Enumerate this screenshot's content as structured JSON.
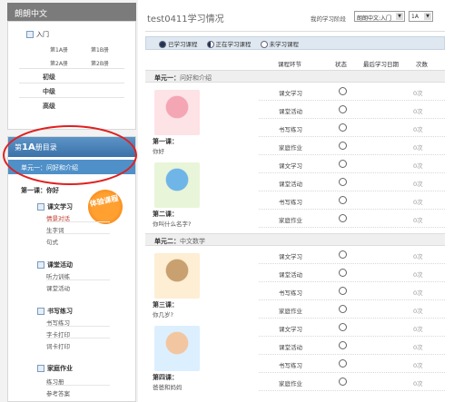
{
  "brand": "朗朗中文",
  "nav": {
    "rumen": "入门",
    "books": [
      "第1A册",
      "第1B册",
      "第2A册",
      "第2B册"
    ],
    "levels": [
      "初级",
      "中级",
      "高级"
    ]
  },
  "directory": {
    "prefix": "第",
    "book": "1A",
    "suffix": "册目录",
    "unit": "单元一：问好和介绍",
    "lesson": "第一课：你好",
    "badge": "体验课程",
    "sections": [
      {
        "title": "课文学习",
        "items": [
          "情景对话",
          "生字词",
          "句式"
        ]
      },
      {
        "title": "课堂活动",
        "items": [
          "听力训练",
          "课堂活动"
        ]
      },
      {
        "title": "书写练习",
        "items": [
          "书写练习",
          "字卡打印",
          "词卡打印"
        ]
      },
      {
        "title": "家庭作业",
        "items": [
          "练习册",
          "参考答案"
        ]
      }
    ]
  },
  "header": {
    "title": "test0411学习情况",
    "stage_label": "我的学习阶段",
    "stage_value": "朗朗中文:入门",
    "book_value": "1A"
  },
  "legend": {
    "done": "已学习课程",
    "doing": "正在学习课程",
    "todo": "未学习课程"
  },
  "columns": {
    "step": "课程环节",
    "status": "状态",
    "last_date": "最后学习日期",
    "times": "次数"
  },
  "units": [
    {
      "label": "单元一：",
      "name": "问好和介绍",
      "lessons": [
        {
          "name": "第一课：",
          "sub": "你好",
          "steps": [
            "课文学习",
            "课堂活动",
            "书写练习",
            "家庭作业"
          ],
          "count": "0次"
        },
        {
          "name": "第二课：",
          "sub": "你叫什么名字?",
          "steps": [
            "课文学习",
            "课堂活动",
            "书写练习",
            "家庭作业"
          ],
          "count": "0次"
        }
      ]
    },
    {
      "label": "单元二：",
      "name": "中文数学",
      "lessons": [
        {
          "name": "第三课：",
          "sub": "你几岁?",
          "steps": [
            "课文学习",
            "课堂活动",
            "书写练习",
            "家庭作业"
          ],
          "count": "0次"
        },
        {
          "name": "第四课：",
          "sub": "爸爸和妈妈",
          "steps": [
            "课文学习",
            "课堂活动",
            "书写练习",
            "家庭作业"
          ],
          "count": "0次"
        }
      ]
    }
  ]
}
